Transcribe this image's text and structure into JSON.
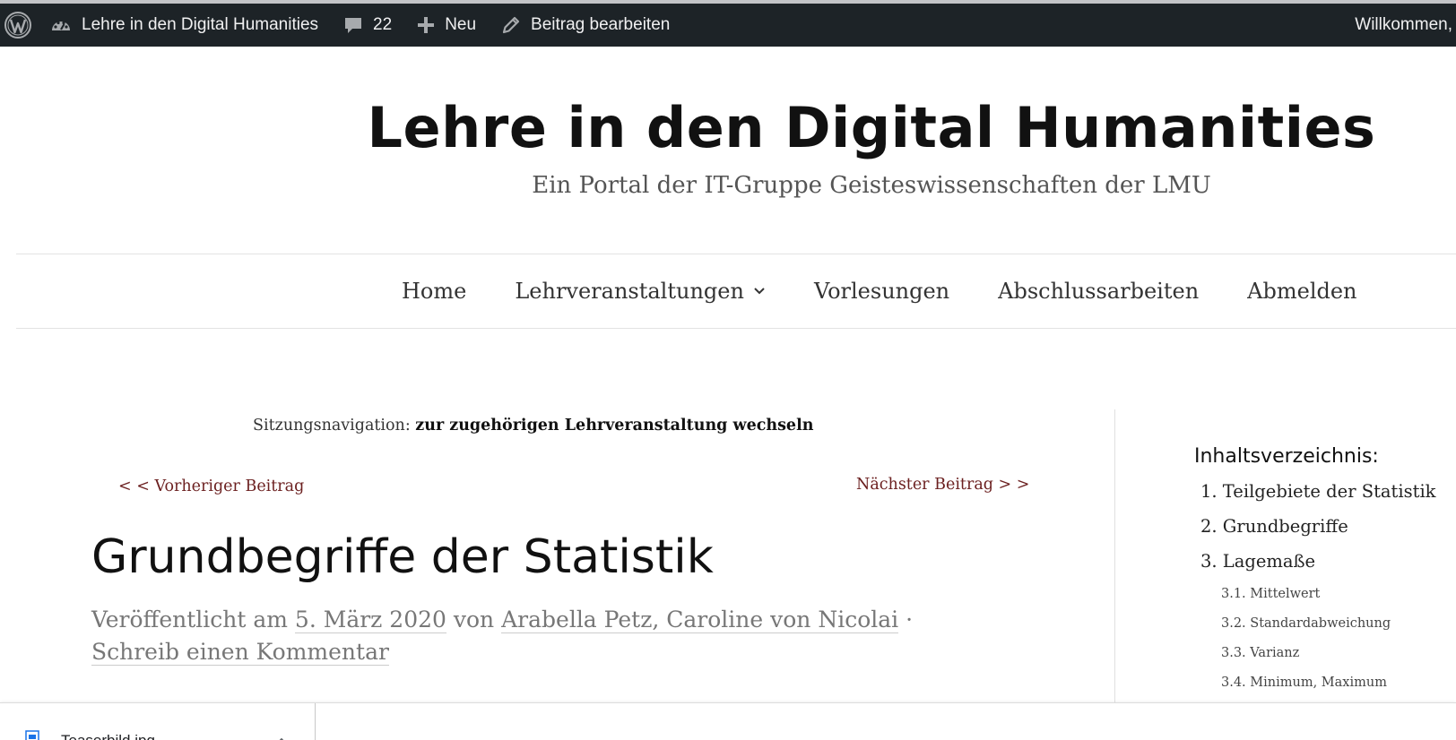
{
  "adminbar": {
    "site_name": "Lehre in den Digital Humanities",
    "comments_count": "22",
    "new_label": "Neu",
    "edit_label": "Beitrag bearbeiten",
    "welcome": "Willkommen,",
    "icons": {
      "wp": "wordpress-logo-icon",
      "dashboard": "dashboard-gauge-icon",
      "comments": "speech-bubble-icon",
      "new": "plus-icon",
      "edit": "pencil-icon"
    }
  },
  "header": {
    "title": "Lehre in den Digital Humanities",
    "description": "Ein Portal der IT-Gruppe Geisteswissenschaften der LMU"
  },
  "nav": {
    "items": [
      {
        "label": "Home"
      },
      {
        "label": "Lehrveranstaltungen",
        "has_dropdown": true
      },
      {
        "label": "Vorlesungen"
      },
      {
        "label": "Abschlussarbeiten"
      },
      {
        "label": "Abmelden"
      }
    ]
  },
  "session_nav": {
    "prefix": "Sitzungsnavigation:",
    "link": "zur zugehörigen Lehrveranstaltung wechseln"
  },
  "post_nav": {
    "prev": "< < Vorheriger Beitrag",
    "next": "Nächster Beitrag > >"
  },
  "post": {
    "title": "Grundbegriffe der Statistik",
    "meta_published": "Veröffentlicht am",
    "meta_date": "5. März 2020",
    "meta_by": "von",
    "meta_authors": "Arabella Petz, Caroline von Nicolai",
    "meta_sep": "·",
    "meta_comment": "Schreib einen Kommentar"
  },
  "toc": {
    "title": "Inhaltsverzeichnis:",
    "items": [
      {
        "label": "1. Teilgebiete der Statistik",
        "level": 1
      },
      {
        "label": "2. Grundbegriffe",
        "level": 1
      },
      {
        "label": "3. Lagemaße",
        "level": 1
      },
      {
        "label": "3.1. Mittelwert",
        "level": 2
      },
      {
        "label": "3.2. Standardabweichung",
        "level": 2
      },
      {
        "label": "3.3. Varianz",
        "level": 2
      },
      {
        "label": "3.4. Minimum, Maximum",
        "level": 2
      }
    ]
  },
  "downloads": {
    "file_name": "Teaserbild.jpg",
    "icons": {
      "file": "image-file-icon",
      "menu": "chevron-up-icon"
    }
  },
  "colors": {
    "adminbar_bg": "#1d2327",
    "link_dark_red": "#6b1f1f",
    "meta_gray": "#777777"
  }
}
